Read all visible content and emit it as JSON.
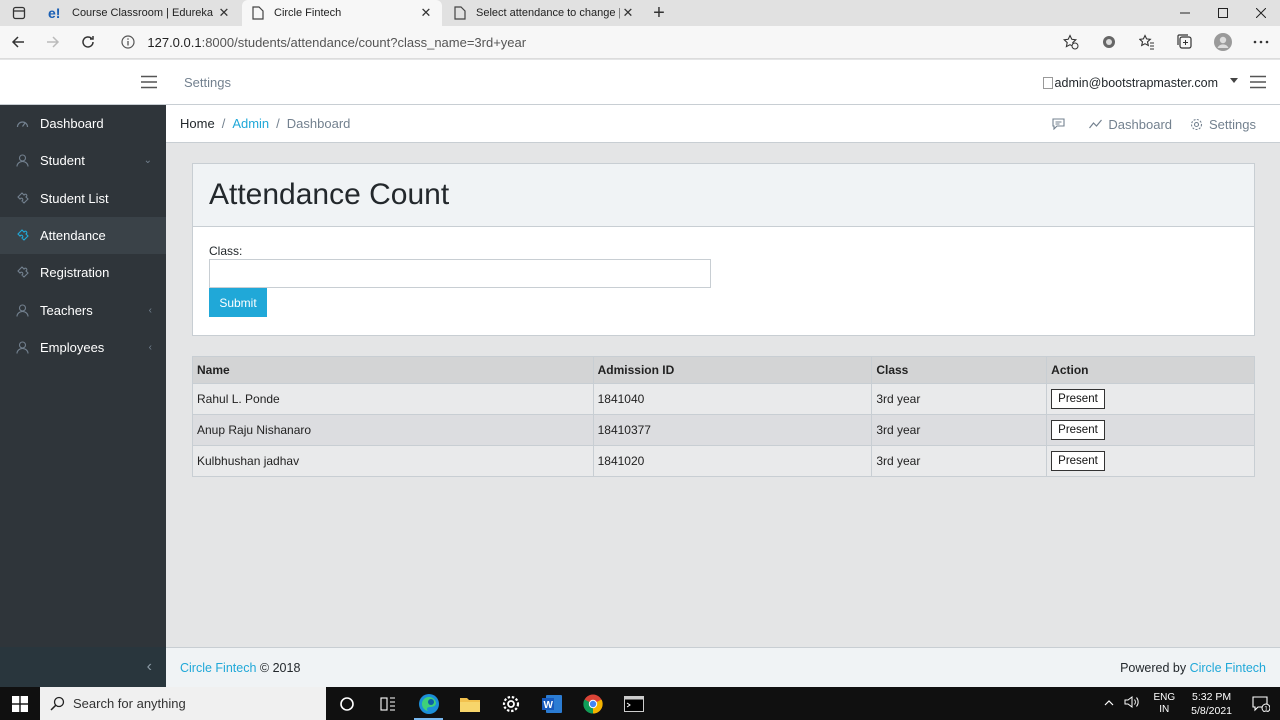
{
  "browser": {
    "tabs": [
      {
        "title": "Course Classroom | Edureka",
        "icon": "edureka-favicon",
        "active": false
      },
      {
        "title": "Circle Fintech",
        "icon": "page-icon",
        "active": true
      },
      {
        "title": "Select attendance to change | Dj",
        "icon": "page-icon",
        "active": false
      }
    ],
    "close_glyph": "✕",
    "new_tab_glyph": "+",
    "url_host": "127.0.0.1",
    "url_rest": ":8000/students/attendance/count?class_name=3rd+year"
  },
  "header": {
    "settings_label": "Settings",
    "user_email": "admin@bootstrapmaster.com"
  },
  "sidebar": {
    "items": [
      {
        "label": "Dashboard",
        "icon": "speedometer-icon",
        "chevron": ""
      },
      {
        "label": "Student",
        "icon": "user-icon",
        "chevron": "⌄"
      },
      {
        "label": "Student List",
        "icon": "puzzle-icon",
        "chevron": ""
      },
      {
        "label": "Attendance",
        "icon": "puzzle-icon",
        "chevron": "",
        "active": true
      },
      {
        "label": "Registration",
        "icon": "puzzle-icon",
        "chevron": ""
      },
      {
        "label": "Teachers",
        "icon": "user-icon",
        "chevron": "‹"
      },
      {
        "label": "Employees",
        "icon": "user-icon",
        "chevron": "‹"
      }
    ],
    "minimizer_glyph": "‹"
  },
  "breadcrumb": {
    "home": "Home",
    "sep": "/",
    "admin": "Admin",
    "current": "Dashboard",
    "right_dashboard": "Dashboard",
    "right_settings": "Settings"
  },
  "card": {
    "title": "Attendance Count",
    "class_label": "Class:",
    "class_value": "",
    "submit_label": "Submit"
  },
  "table": {
    "headers": [
      "Name",
      "Admission ID",
      "Class",
      "Action"
    ],
    "rows": [
      {
        "name": "Rahul L. Ponde",
        "admission_id": "1841040",
        "class": "3rd year",
        "action": "Present"
      },
      {
        "name": "Anup Raju Nishanaro",
        "admission_id": "18410377",
        "class": "3rd year",
        "action": "Present"
      },
      {
        "name": "Kulbhushan jadhav",
        "admission_id": "1841020",
        "class": "3rd year",
        "action": "Present"
      }
    ]
  },
  "footer": {
    "brand": "Circle Fintech",
    "copyright": "© 2018",
    "powered_by": "Powered by",
    "powered_brand": "Circle Fintech"
  },
  "taskbar": {
    "search_placeholder": "Search for anything",
    "lang_line1": "ENG",
    "lang_line2": "IN",
    "time": "5:32 PM",
    "date": "5/8/2021",
    "notification_count": "1"
  },
  "colors": {
    "accent": "#20a8d8",
    "sidebar_bg": "#2f353a",
    "sidebar_active": "#3a4248"
  }
}
